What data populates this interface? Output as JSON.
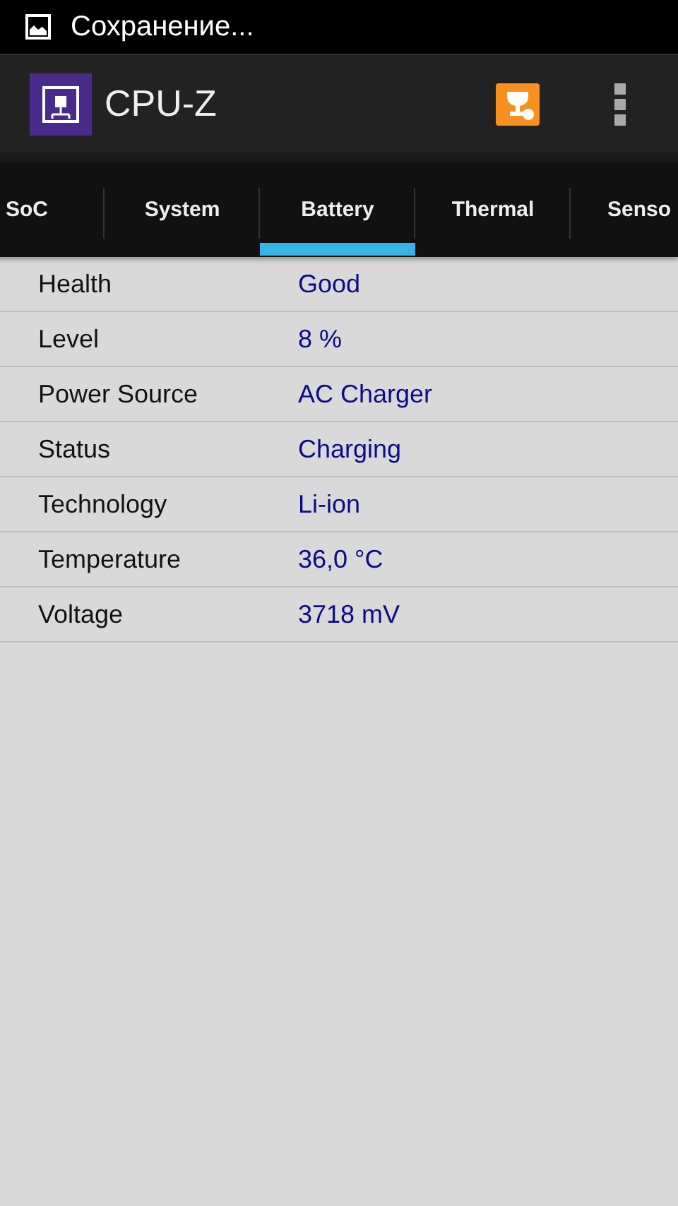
{
  "status_bar": {
    "notification": "Сохранение..."
  },
  "app_bar": {
    "title": "CPU-Z"
  },
  "tabs": [
    {
      "label": "SoC",
      "selected": false
    },
    {
      "label": "System",
      "selected": false
    },
    {
      "label": "Battery",
      "selected": true
    },
    {
      "label": "Thermal",
      "selected": false
    },
    {
      "label": "Senso",
      "selected": false
    }
  ],
  "rows": [
    {
      "label": "Health",
      "value": "Good"
    },
    {
      "label": "Level",
      "value": "8 %"
    },
    {
      "label": "Power Source",
      "value": "AC Charger"
    },
    {
      "label": "Status",
      "value": "Charging"
    },
    {
      "label": "Technology",
      "value": "Li-ion"
    },
    {
      "label": "Temperature",
      "value": "36,0 °C"
    },
    {
      "label": "Voltage",
      "value": "3718 mV"
    }
  ]
}
